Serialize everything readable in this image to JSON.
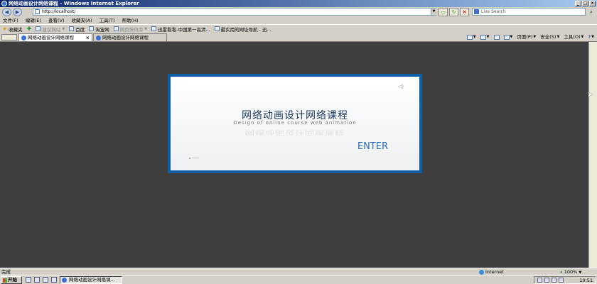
{
  "window": {
    "title": "网络动画设计网络课程 - Windows Internet Explorer"
  },
  "address": {
    "url": "http://localhost/",
    "search_placeholder": "Live Search"
  },
  "menu": [
    {
      "label": "文件(F)"
    },
    {
      "label": "编辑(E)"
    },
    {
      "label": "查看(V)"
    },
    {
      "label": "收藏夹(A)"
    },
    {
      "label": "工具(T)"
    },
    {
      "label": "帮助(H)"
    }
  ],
  "favorites": {
    "favorites_label": "收藏夹",
    "items": [
      {
        "label": "建议网站"
      },
      {
        "label": "百度"
      },
      {
        "label": "淘宝网"
      },
      {
        "label": "网页快讯库"
      },
      {
        "label": "迅雷看看-中国第一高清..."
      },
      {
        "label": "最实用的网址导航 - 迅..."
      }
    ]
  },
  "tabs": [
    {
      "label": "网络动画设计网络课程"
    },
    {
      "label": "网络动画设计网络课程"
    }
  ],
  "commands": {
    "page": "页面(P)",
    "safety": "安全(S)",
    "tools": "工具(O)"
  },
  "page": {
    "title_cn": "网络动画设计网络课程",
    "subtitle_en": "Design of online course web animation",
    "enter_label": "ENTER"
  },
  "status": {
    "text": "完成",
    "zone": "Internet",
    "zoom": "100%"
  },
  "taskbar": {
    "start_label": "开始",
    "task_label": "网络动画设计网络课...",
    "clock": "10:51"
  },
  "colors": {
    "content_bg": "#3e3e3e",
    "card_border": "#0a5fa5",
    "enter": "#2a6fbf",
    "title": "#1d3a63"
  }
}
